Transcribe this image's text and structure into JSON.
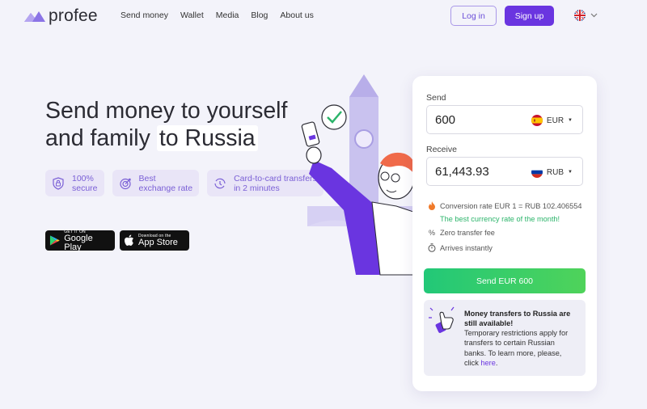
{
  "header": {
    "logo_text": "profee",
    "nav": [
      "Send money",
      "Wallet",
      "Media",
      "Blog",
      "About us"
    ],
    "login_label": "Log in",
    "signup_label": "Sign up",
    "language_icon": "uk-flag-icon"
  },
  "hero": {
    "title_line1": "Send money to yourself",
    "title_line2_prefix": "and family",
    "title_line2_highlight": "to Russia",
    "features": [
      {
        "icon": "lock-icon",
        "line1": "100%",
        "line2": "secure"
      },
      {
        "icon": "target-icon",
        "line1": "Best",
        "line2": "exchange rate"
      },
      {
        "icon": "clock-arrows-icon",
        "line1": "Card-to-card transfers",
        "line2": "in 2 minutes"
      }
    ],
    "stores": [
      {
        "small": "GET IT ON",
        "big": "Google Play"
      },
      {
        "small": "Download on the",
        "big": "App Store"
      }
    ]
  },
  "converter": {
    "send_label": "Send",
    "send_value": "600",
    "send_currency": "EUR",
    "receive_label": "Receive",
    "receive_value": "61,443.93",
    "receive_currency": "RUB",
    "conversion_rate": "Conversion rate EUR 1 = RUB 102.406554",
    "best_rate_note": "The best currency rate of the month!",
    "fee": "Zero transfer fee",
    "arrival": "Arrives instantly",
    "send_button": "Send EUR 600",
    "notice_title": "Money transfers to Russia are still available!",
    "notice_body": "Temporary restrictions apply for transfers to certain Russian banks. To learn more, please, click ",
    "notice_link": "here",
    "notice_end": "."
  },
  "colors": {
    "accent": "#6a35e0",
    "green": "#2bb46a",
    "background": "#f3f3fa"
  }
}
